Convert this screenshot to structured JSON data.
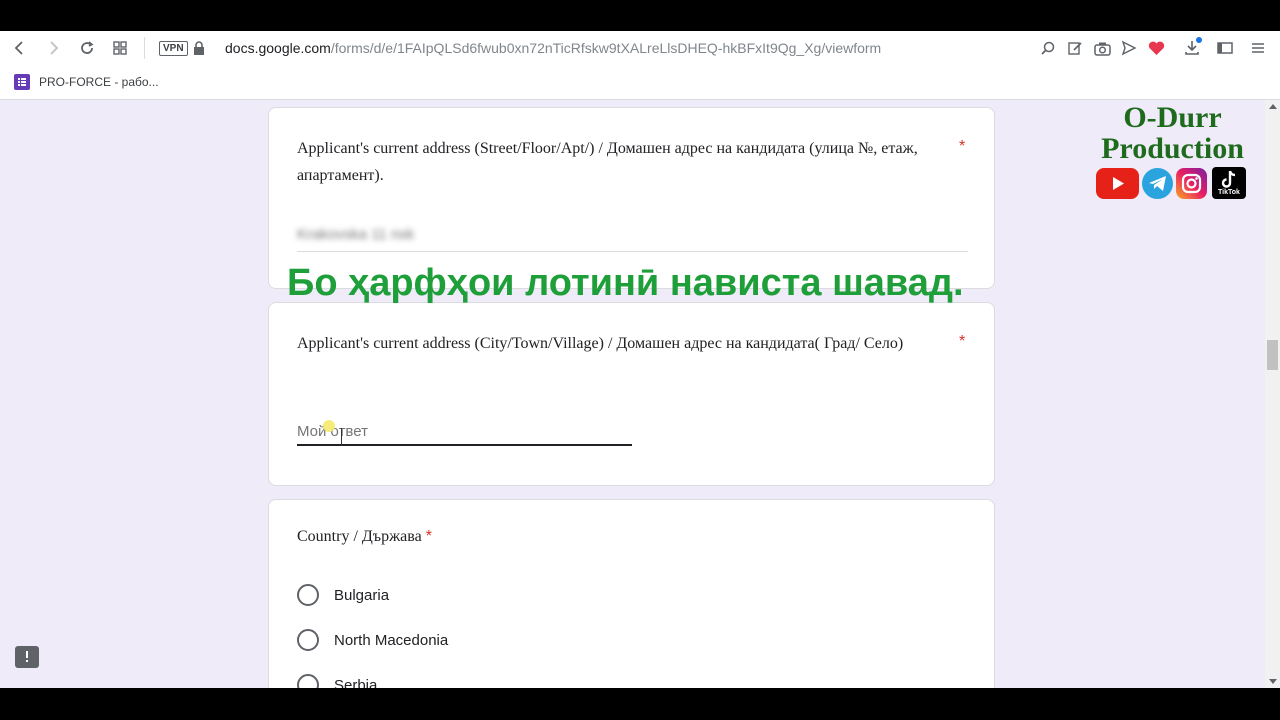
{
  "browser": {
    "vpn_label": "VPN",
    "url_domain": "docs.google.com",
    "url_path": "/forms/d/e/1FAIpQLSd6fwub0xn72nTicRfskw9tXALreLlsDHEQ-hkBFxIt9Qg_Xg/viewform",
    "bookmark_label": "PRO-FORCE - рабо..."
  },
  "form": {
    "q1_title": "Applicant's current address (Street/Floor/Apt/) / Домашен адрес на кандидата (улица №, етаж, апартамент).",
    "q1_answer_blurred": "Krakovska 11 nsk",
    "q2_title": "Applicant's current address (City/Town/Village) / Домашен адрес на кандидата( Град/ Село)",
    "q2_placeholder": "Мой ответ",
    "q3_title": "Country / Държава",
    "required_mark": "*",
    "country_options": [
      "Bulgaria",
      "North Macedonia",
      "Serbia"
    ]
  },
  "overlay": {
    "caption": "Бо ҳарфҳои лотинӣ нависта шавад.",
    "brand_line1": "O-Durr",
    "brand_line2": "Production",
    "tiktok_label": "TikTok"
  },
  "colors": {
    "caption": "#1f9f3a",
    "brand": "#1e6b1e",
    "form_bg": "#f0ebf8",
    "required": "#d93025"
  }
}
